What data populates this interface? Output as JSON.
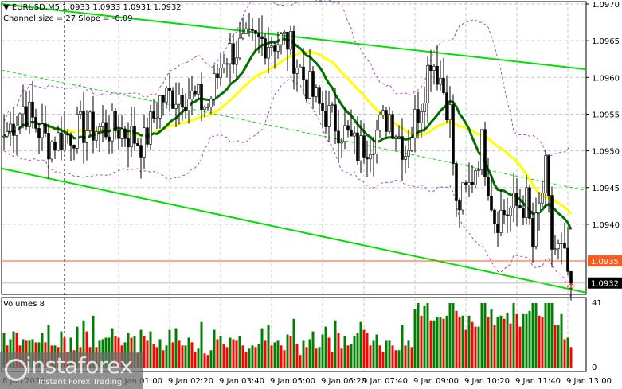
{
  "header": {
    "symbol_line": "EURUSD,M5  1.0933 1.0933 1.0931 1.0932",
    "channel_line": "Channel size = 27 Slope = -0.09"
  },
  "volume_pane": {
    "label": "Volumes 8",
    "max_label": "41",
    "min_label": "0"
  },
  "watermark": {
    "brand": "instaforex",
    "tagline": "Instant Forex Trading"
  },
  "colors": {
    "up_volume": "#008000",
    "down_volume": "#ff0000",
    "channel": "#00e000",
    "ma_fast": "#007000",
    "ma_slow": "#ffff00",
    "bands": "#aa44cc",
    "bid_line": "#ff5a1e",
    "current": "#000000"
  },
  "chart_data": {
    "type": "candlestick",
    "symbol": "EURUSD",
    "timeframe": "M5",
    "ylim": [
      1.0929,
      1.0971
    ],
    "y_ticks": [
      "1.0970",
      "1.0965",
      "1.0960",
      "1.0955",
      "1.0950",
      "1.0945",
      "1.0940"
    ],
    "x_ticks": [
      "8 Jan 2024",
      "9 Jan 01:00",
      "9 Jan 02:20",
      "9 Jan 03:40",
      "9 Jan 05:00",
      "9 Jan 06:20",
      "9 Jan 07:40",
      "9 Jan 09:00",
      "9 Jan 10:20",
      "9 Jan 11:40",
      "9 Jan 13:00"
    ],
    "x_tick_bars": [
      0,
      36,
      52,
      68,
      84,
      100,
      113,
      129,
      145,
      161,
      177
    ],
    "price_path": [
      [
        0,
        1.0952
      ],
      [
        6,
        1.0956
      ],
      [
        14,
        1.0951
      ],
      [
        24,
        1.0953
      ],
      [
        36,
        1.0953
      ],
      [
        44,
        1.0951
      ],
      [
        49,
        1.0957
      ],
      [
        56,
        1.0958
      ],
      [
        64,
        1.0956
      ],
      [
        69,
        1.0963
      ],
      [
        74,
        1.0964
      ],
      [
        81,
        1.0965
      ],
      [
        89,
        1.0965
      ],
      [
        94,
        1.096
      ],
      [
        99,
        1.0956
      ],
      [
        106,
        1.0953
      ],
      [
        111,
        1.095
      ],
      [
        116,
        1.0952
      ],
      [
        121,
        1.0955
      ],
      [
        126,
        1.095
      ],
      [
        131,
        1.0957
      ],
      [
        134,
        1.0963
      ],
      [
        137,
        1.096
      ],
      [
        140,
        1.0955
      ],
      [
        142,
        1.0942
      ],
      [
        146,
        1.0945
      ],
      [
        150,
        1.0951
      ],
      [
        154,
        1.0941
      ],
      [
        159,
        1.0942
      ],
      [
        164,
        1.0943
      ],
      [
        166,
        1.0937
      ],
      [
        170,
        1.0947
      ],
      [
        172,
        1.0937
      ],
      [
        175,
        1.0936
      ],
      [
        178,
        1.0932
      ]
    ],
    "bid_price": "1.0935",
    "current_price": "1.0932",
    "channel": {
      "upper": [
        1.097,
        1.09611
      ],
      "middle": [
        1.0961,
        1.09446
      ],
      "lower": [
        1.09476,
        1.09307
      ]
    },
    "volume_range": [
      0,
      41
    ]
  }
}
